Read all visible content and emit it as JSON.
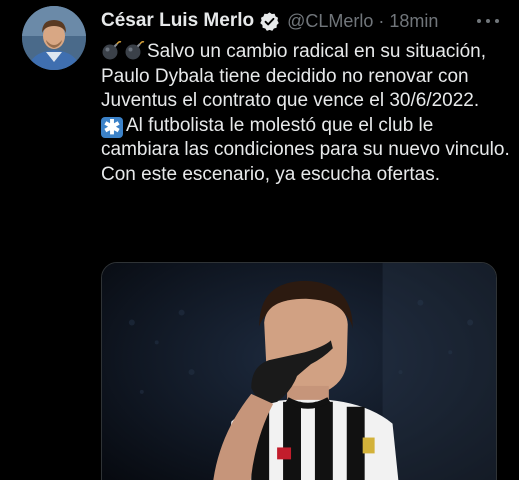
{
  "tweet": {
    "author_name": "César Luis Merlo",
    "handle": "@CLMerlo",
    "separator": "·",
    "time": "18min",
    "emoji_lead": "💣💣",
    "text_1": "Salvo un cambio radical en su situación, Paulo Dybala tiene decidido no renovar con Juventus el contrato que vence el 30/6/2022.",
    "emoji_asterisk": "✳️",
    "text_2": "Al futbolista le molestó que el club le cambiara las condiciones para su nuevo vinculo. Con este escenario, ya escucha ofertas."
  },
  "icons": {
    "verified": "verified-badge-icon",
    "more": "more-options-icon",
    "bomb": "bomb-emoji",
    "asterisk": "eight-spoked-asterisk-emoji"
  },
  "colors": {
    "background": "#000000",
    "text": "#e7e9ea",
    "secondary": "#71767b",
    "verified": "#e7e9ea",
    "kit_black": "#111111",
    "kit_white": "#f2f2f2"
  }
}
